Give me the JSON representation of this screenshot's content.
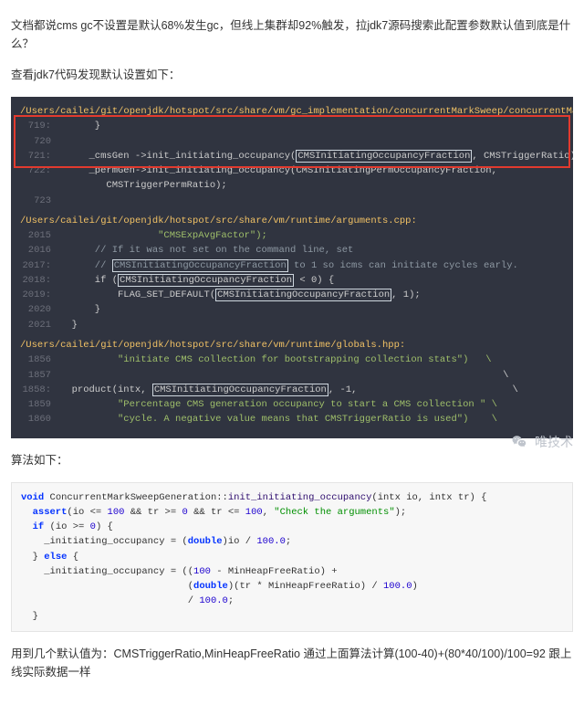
{
  "intro": "文档都说cms gc不设置是默认68%发生gc，但线上集群却92%触发，拉jdk7源码搜索此配置参数默认值到底是什么？",
  "heading1": "查看jdk7代码发现默认设置如下：",
  "block1": {
    "path1": "/Users/cailei/git/openjdk/hotspot/src/share/vm/gc_implementation/concurrentMarkSweep/concurrentMarkSweepGeneration.cpp:",
    "l719": "      }",
    "l720": "",
    "l721_a": "     _cmsGen ->init_initiating_occupancy(",
    "l721_b": "CMSInitiatingOccupancyFraction",
    "l721_c": ", CMSTriggerRatio);",
    "l722_a": "     _permGen->init_initiating_occupancy(CMSInitiatingPermOccupancyFraction,",
    "l722_b": "        CMSTriggerPermRatio);",
    "l723": "",
    "path2": "/Users/cailei/git/openjdk/hotspot/src/share/vm/runtime/arguments.cpp:",
    "l2015": "                 \"CMSExpAvgFactor\");",
    "l2016": "      // If it was not set on the command line, set",
    "l2017_a": "      // ",
    "l2017_b": "CMSInitiatingOccupancyFraction",
    "l2017_c": " to 1 so icms can initiate cycles early.",
    "l2018_a": "      if (",
    "l2018_b": "CMSInitiatingOccupancyFraction",
    "l2018_c": " < 0) {",
    "l2019_a": "          FLAG_SET_DEFAULT(",
    "l2019_b": "CMSInitiatingOccupancyFraction",
    "l2019_c": ", 1);",
    "l2020": "      }",
    "l2021": "  }",
    "path3": "/Users/cailei/git/openjdk/hotspot/src/share/vm/runtime/globals.hpp:",
    "l1856": "          \"initiate CMS collection for bootstrapping collection stats\")   \\",
    "l1857": "                                                                             \\",
    "l1858_a": "  product(intx, ",
    "l1858_b": "CMSInitiatingOccupancyFraction",
    "l1858_c": ", -1,                           \\",
    "l1859": "          \"Percentage CMS generation occupancy to start a CMS collection \" \\",
    "l1860": "          \"cycle. A negative value means that CMSTriggerRatio is used\")    \\"
  },
  "heading2": "算法如下：",
  "block2": {
    "l1a": "void",
    "l1b": " ConcurrentMarkSweepGeneration::",
    "l1c": "init_initiating_occupancy",
    "l1d": "(intx io, intx tr) {",
    "l2a": "  assert",
    "l2b": "(io <= ",
    "l2c": "100",
    "l2d": " && tr >= ",
    "l2e": "0",
    "l2f": " && tr <= ",
    "l2g": "100",
    "l2h": ", ",
    "l2i": "\"Check the arguments\"",
    "l2j": ");",
    "l3a": "  if",
    "l3b": " (io >= ",
    "l3c": "0",
    "l3d": ") {",
    "l4a": "    _initiating_occupancy = (",
    "l4b": "double",
    "l4c": ")io / ",
    "l4d": "100.0",
    "l4e": ";",
    "l5a": "  } ",
    "l5b": "else",
    "l5c": " {",
    "l6a": "    _initiating_occupancy = ((",
    "l6b": "100",
    "l6c": " - MinHeapFreeRatio) +",
    "l7a": "                             (",
    "l7b": "double",
    "l7c": ")(tr * MinHeapFreeRatio) / ",
    "l7d": "100.0",
    "l7e": ")",
    "l8a": "                             / ",
    "l8b": "100.0",
    "l8c": ";",
    "l9": "  }"
  },
  "conclusion": "用到几个默认值为：CMSTriggerRatio,MinHeapFreeRatio 通过上面算法计算(100-40)+(80*40/100)/100=92 跟上线实际数据一样",
  "watermark": "唯技术"
}
